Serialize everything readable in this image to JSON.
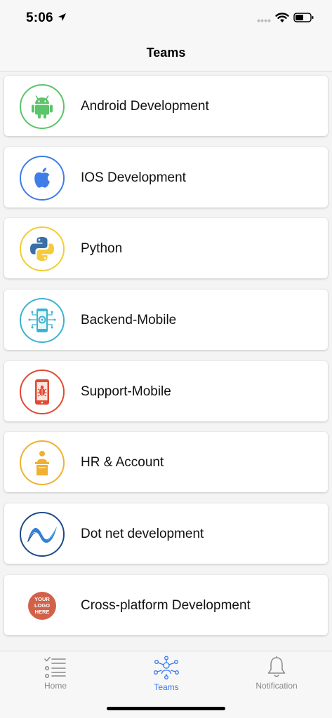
{
  "status_bar": {
    "time": "5:06"
  },
  "nav": {
    "title": "Teams"
  },
  "teams": [
    {
      "name": "Android Development",
      "icon": "android-icon",
      "ring_color": "#5cc46a"
    },
    {
      "name": "IOS Development",
      "icon": "apple-icon",
      "ring_color": "#3f7de8"
    },
    {
      "name": "Python",
      "icon": "python-icon",
      "ring_color": "#f2cd33"
    },
    {
      "name": "Backend-Mobile",
      "icon": "mobile-gear-icon",
      "ring_color": "#3cb3d0"
    },
    {
      "name": "Support-Mobile",
      "icon": "mobile-bug-icon",
      "ring_color": "#e04a32"
    },
    {
      "name": "HR & Account",
      "icon": "speaker-podium-icon",
      "ring_color": "#f0b032"
    },
    {
      "name": "Dot net development",
      "icon": "dotnet-icon",
      "ring_color": "#1d4a8c"
    },
    {
      "name": "Cross-platform Development",
      "icon": "logo-placeholder-icon",
      "logo_text": [
        "YOUR",
        "LOGO",
        "HERE"
      ]
    }
  ],
  "tabs": [
    {
      "label": "Home",
      "icon": "checklist-icon",
      "active": false
    },
    {
      "label": "Teams",
      "icon": "team-network-icon",
      "active": true
    },
    {
      "label": "Notification",
      "icon": "bell-icon",
      "active": false
    }
  ],
  "colors": {
    "accent": "#3478f6",
    "inactive": "#8a8a8a"
  }
}
